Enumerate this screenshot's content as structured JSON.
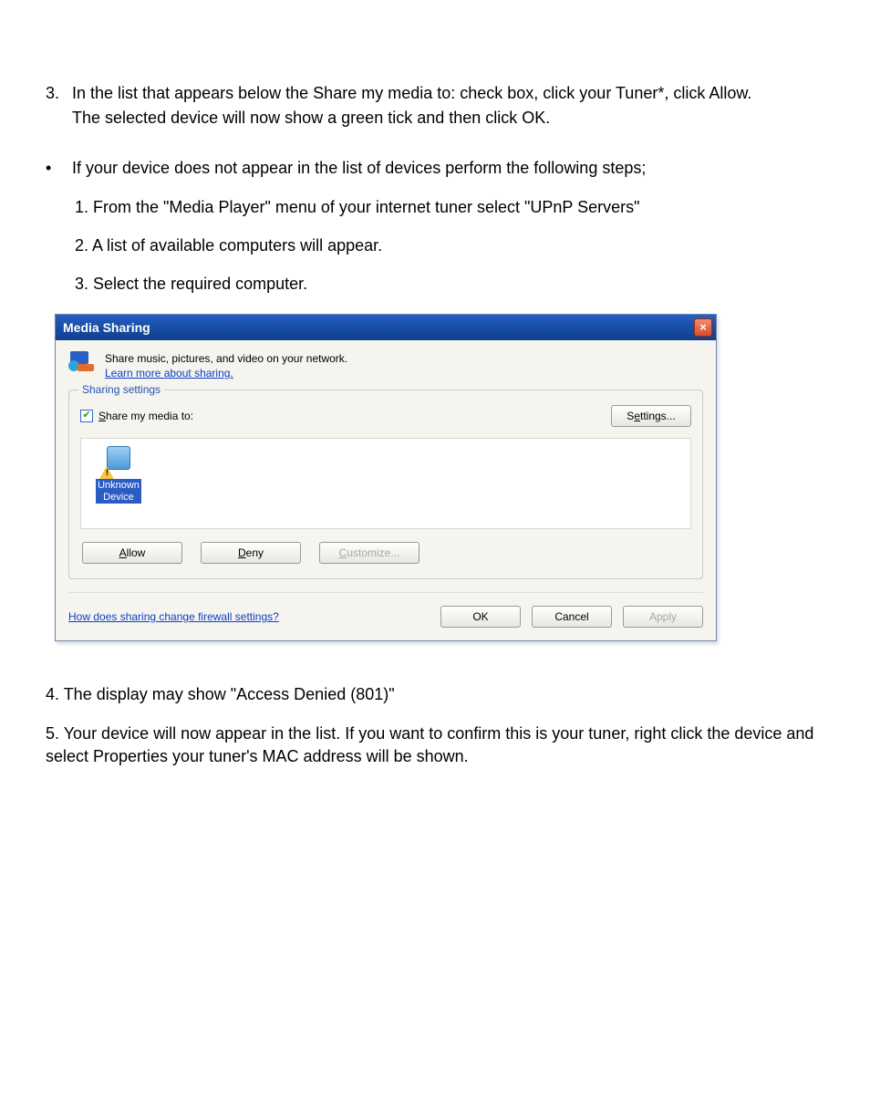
{
  "step3": {
    "number": "3.",
    "line1": "In the list that appears below the Share my media to: check box, click your Tuner*, click Allow.",
    "line2": "The selected device will now show a green tick and then click OK."
  },
  "bullet": {
    "dot": "•",
    "text": "If your device does not appear in the list of devices perform the following steps;"
  },
  "sub": {
    "s1": "1. From the \"Media Player\" menu of your internet tuner select \"UPnP Servers\"",
    "s2": "2. A list of available computers will appear.",
    "s3": "3. Select the required computer."
  },
  "dialog": {
    "title": "Media Sharing",
    "close_glyph": "×",
    "intro_text": "Share music, pictures, and video on your network.",
    "learn_more": "Learn more about sharing.",
    "group_legend": "Sharing settings",
    "share_prefix": "S",
    "share_rest": "hare my media to:",
    "settings_prefix": "S",
    "settings_e": "e",
    "settings_rest": "ttings...",
    "device_line1": "Unknown",
    "device_line2": "Device",
    "allow_a": "A",
    "allow_rest": "llow",
    "deny_d": "D",
    "deny_rest": "eny",
    "customize_c": "C",
    "customize_rest": "ustomize...",
    "firewall_link": "How does sharing change firewall settings?",
    "ok": "OK",
    "cancel": "Cancel",
    "apply": "Apply"
  },
  "post": {
    "p4": "4. The display may show \"Access Denied (801)\"",
    "p5": "5. Your device will now appear in the list.  If you want to confirm this is your tuner, right click the device and select Properties your tuner's MAC address will be shown."
  }
}
